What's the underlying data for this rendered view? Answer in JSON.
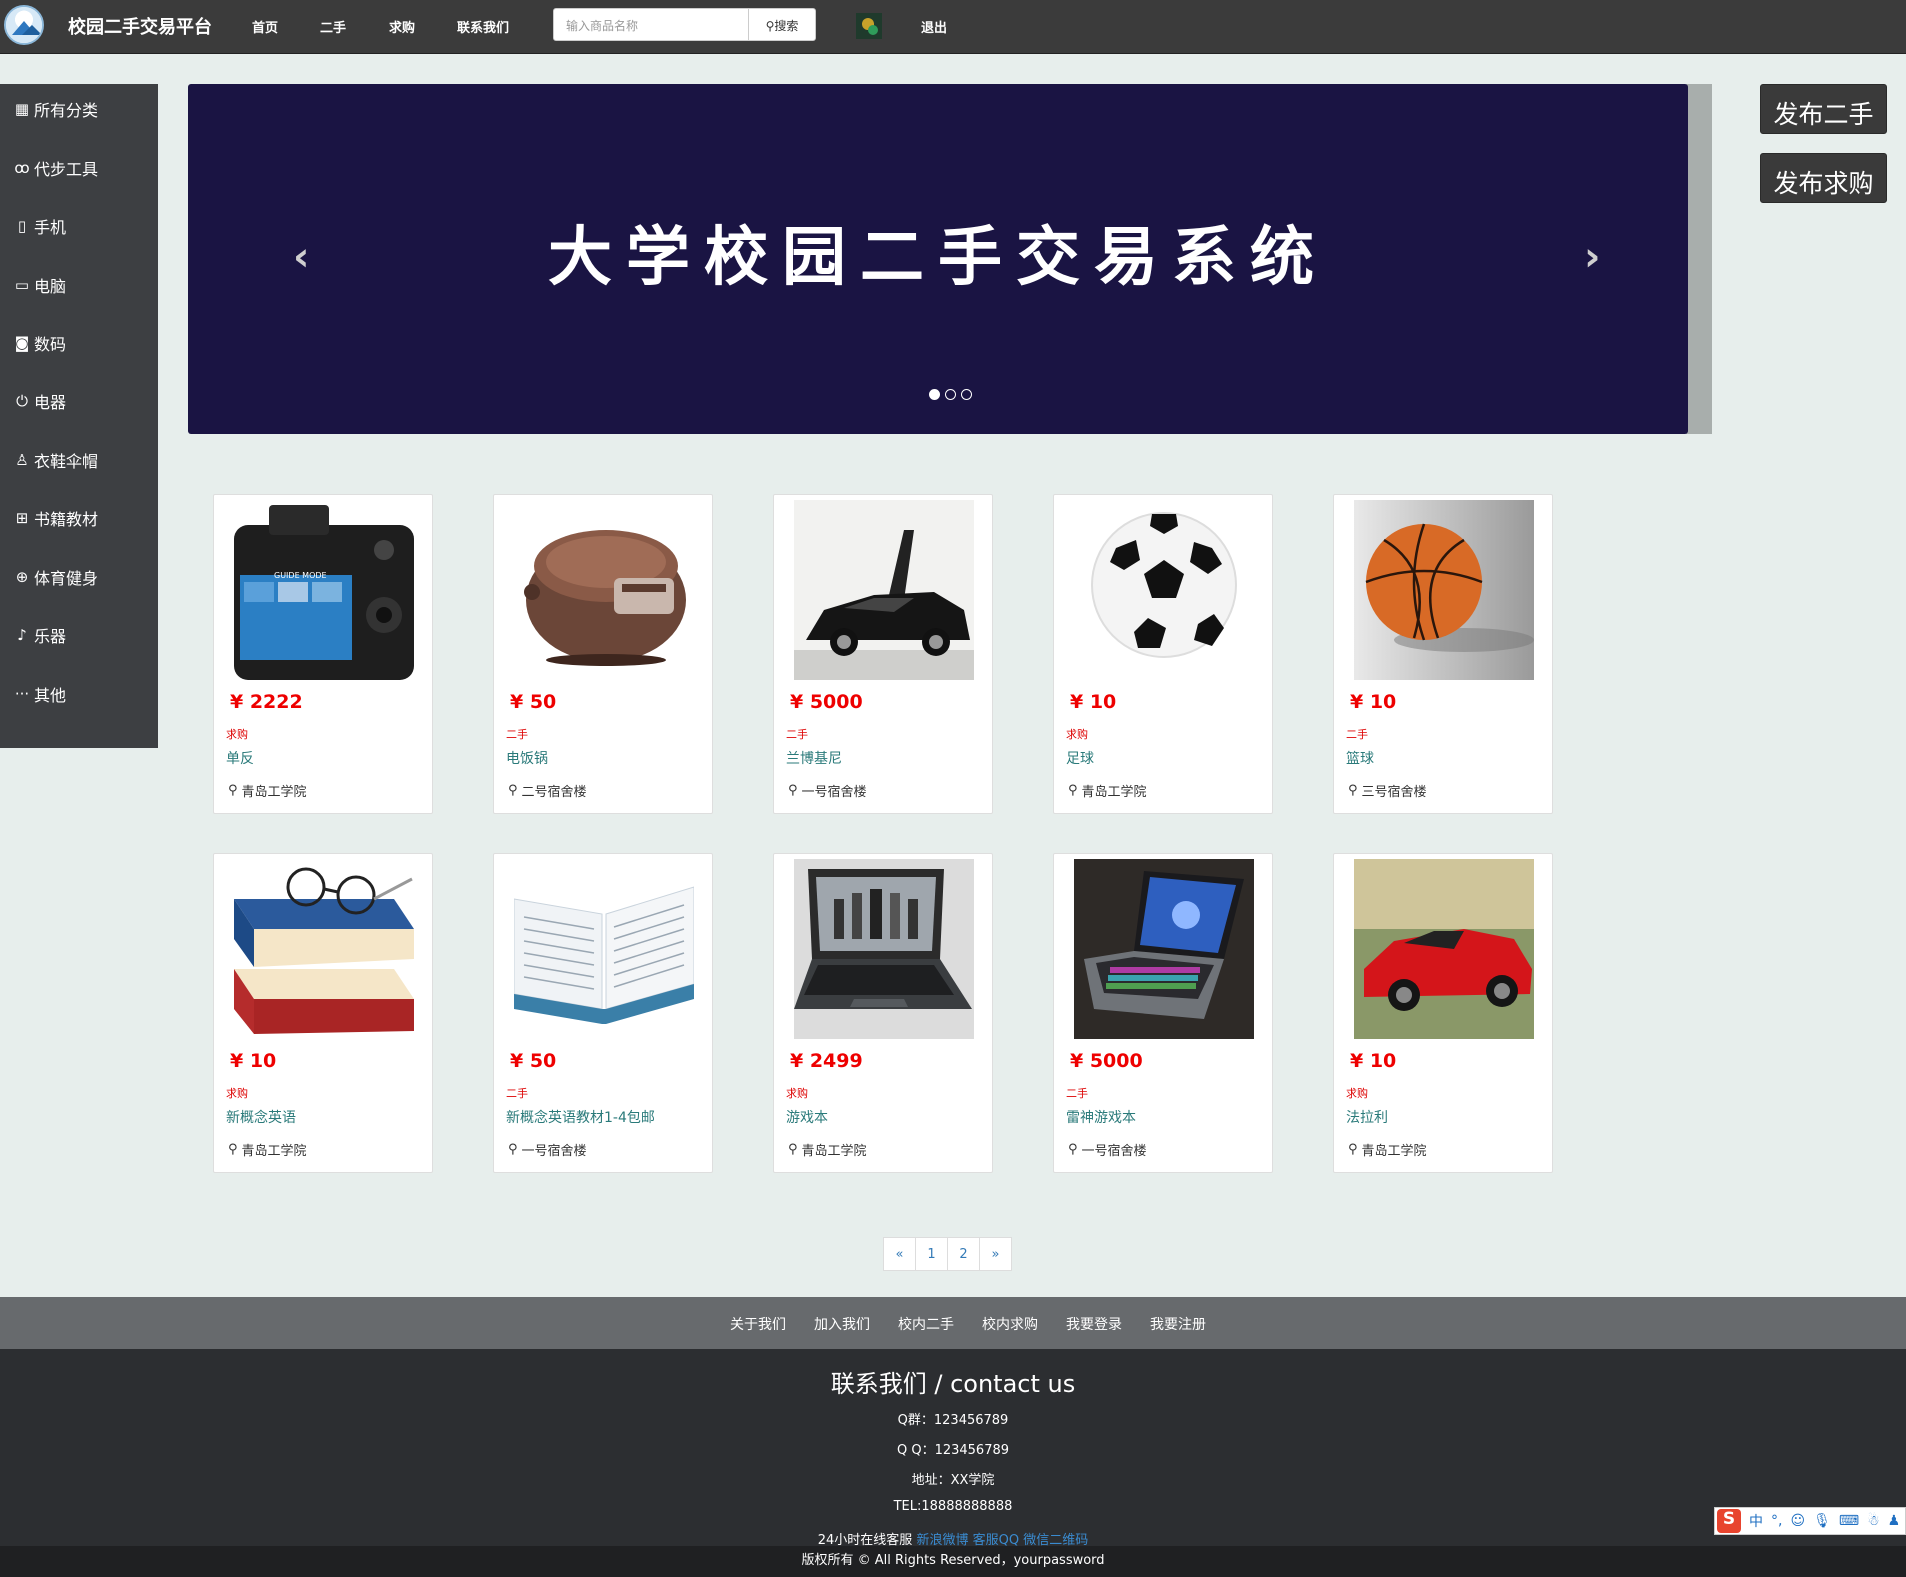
{
  "header": {
    "brand": "校园二手交易平台",
    "nav": [
      "首页",
      "二手",
      "求购",
      "联系我们"
    ],
    "search_placeholder": "输入商品名称",
    "search_button": "搜索",
    "logout": "退出"
  },
  "sidebar": {
    "items": [
      {
        "label": "所有分类",
        "icon": "grid-icon"
      },
      {
        "label": "代步工具",
        "icon": "bicycle-icon"
      },
      {
        "label": "手机",
        "icon": "phone-icon"
      },
      {
        "label": "电脑",
        "icon": "monitor-icon"
      },
      {
        "label": "数码",
        "icon": "camera-icon"
      },
      {
        "label": "电器",
        "icon": "plug-icon"
      },
      {
        "label": "衣鞋伞帽",
        "icon": "shirt-icon"
      },
      {
        "label": "书籍教材",
        "icon": "book-icon"
      },
      {
        "label": "体育健身",
        "icon": "ball-icon"
      },
      {
        "label": "乐器",
        "icon": "guitar-icon"
      },
      {
        "label": "其他",
        "icon": "dots-icon"
      }
    ]
  },
  "carousel": {
    "title": "大学校园二手交易系统",
    "prev": "‹",
    "next": "›",
    "active_slide": 1,
    "slide_count": 3
  },
  "actions": {
    "publish_secondhand": "发布二手",
    "publish_wanted": "发布求购"
  },
  "products": [
    {
      "price": "¥ 2222",
      "tag": "求购",
      "name": "单反",
      "location": "青岛工学院",
      "image": "camera-photo"
    },
    {
      "price": "¥ 50",
      "tag": "二手",
      "name": "电饭锅",
      "location": "二号宿舍楼",
      "image": "rice-cooker-photo"
    },
    {
      "price": "¥ 5000",
      "tag": "二手",
      "name": "兰博基尼",
      "location": "一号宿舍楼",
      "image": "lamborghini-photo"
    },
    {
      "price": "¥ 10",
      "tag": "求购",
      "name": "足球",
      "location": "青岛工学院",
      "image": "soccer-ball-photo"
    },
    {
      "price": "¥ 10",
      "tag": "二手",
      "name": "篮球",
      "location": "三号宿舍楼",
      "image": "basketball-photo"
    },
    {
      "price": "¥ 10",
      "tag": "求购",
      "name": "新概念英语",
      "location": "青岛工学院",
      "image": "books-glasses-photo"
    },
    {
      "price": "¥ 50",
      "tag": "二手",
      "name": "新概念英语教材1-4包邮",
      "location": "一号宿舍楼",
      "image": "open-book-photo"
    },
    {
      "price": "¥ 2499",
      "tag": "求购",
      "name": "游戏本",
      "location": "青岛工学院",
      "image": "gaming-laptop-photo"
    },
    {
      "price": "¥ 5000",
      "tag": "二手",
      "name": "雷神游戏本",
      "location": "一号宿舍楼",
      "image": "thunderobot-laptop-photo"
    },
    {
      "price": "¥ 10",
      "tag": "求购",
      "name": "法拉利",
      "location": "青岛工学院",
      "image": "ferrari-photo"
    }
  ],
  "pagination": [
    "«",
    "1",
    "2",
    "»"
  ],
  "footer": {
    "links": [
      "关于我们",
      "加入我们",
      "校内二手",
      "校内求购",
      "我要登录",
      "我要注册"
    ],
    "title": "联系我们 / contact us",
    "qgroup": "Q群：123456789",
    "qq": "Q Q：123456789",
    "address": "地址：XX学院",
    "tel": "TEL:18888888888",
    "service": "24小时在线客服",
    "service_links": [
      "新浪微博",
      "客服QQ",
      "微信二维码"
    ],
    "copyright": "版权所有 © All Rights Reserved，yourpassword"
  },
  "ime": {
    "logo": "S",
    "lang": "中"
  },
  "colors": {
    "navbar": "#3b3b3b",
    "sidebar": "#3d3f42",
    "carousel": "#1a1443",
    "price": "#ee0000",
    "page_bg": "#e7eeec",
    "footer": "#2c2e31"
  }
}
